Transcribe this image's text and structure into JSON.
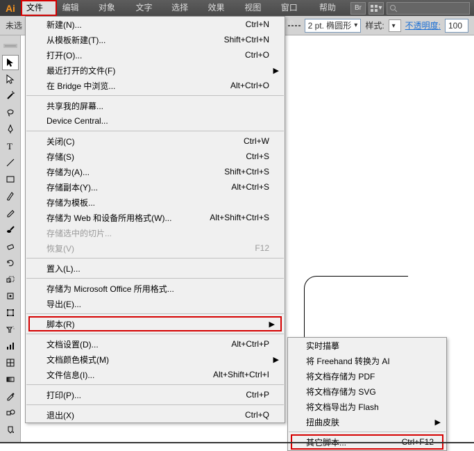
{
  "menubar": {
    "file": "文件(F)",
    "edit": "编辑(E)",
    "object": "对象(O)",
    "text": "文字(T)",
    "select": "选择(S)",
    "effect": "效果(C)",
    "view": "视图(V)",
    "window": "窗口(W)",
    "help": "帮助(H)",
    "br_btn": "Br"
  },
  "optbar": {
    "left_label": "未选",
    "stroke_opts": "2 pt. 椭圆形",
    "style_label": "样式:",
    "opacity_label": "不透明度:",
    "opacity_value": "100"
  },
  "file_menu": [
    {
      "type": "item",
      "label": "新建(N)...",
      "shortcut": "Ctrl+N"
    },
    {
      "type": "item",
      "label": "从模板新建(T)...",
      "shortcut": "Shift+Ctrl+N"
    },
    {
      "type": "item",
      "label": "打开(O)...",
      "shortcut": "Ctrl+O"
    },
    {
      "type": "item",
      "label": "最近打开的文件(F)",
      "shortcut": "",
      "submenu": true
    },
    {
      "type": "item",
      "label": "在 Bridge 中浏览...",
      "shortcut": "Alt+Ctrl+O"
    },
    {
      "type": "sep"
    },
    {
      "type": "item",
      "label": "共享我的屏幕...",
      "shortcut": ""
    },
    {
      "type": "item",
      "label": "Device Central...",
      "shortcut": ""
    },
    {
      "type": "sep"
    },
    {
      "type": "item",
      "label": "关闭(C)",
      "shortcut": "Ctrl+W"
    },
    {
      "type": "item",
      "label": "存储(S)",
      "shortcut": "Ctrl+S"
    },
    {
      "type": "item",
      "label": "存储为(A)...",
      "shortcut": "Shift+Ctrl+S"
    },
    {
      "type": "item",
      "label": "存储副本(Y)...",
      "shortcut": "Alt+Ctrl+S"
    },
    {
      "type": "item",
      "label": "存储为模板...",
      "shortcut": ""
    },
    {
      "type": "item",
      "label": "存储为 Web 和设备所用格式(W)...",
      "shortcut": "Alt+Shift+Ctrl+S"
    },
    {
      "type": "item",
      "label": "存储选中的切片...",
      "shortcut": "",
      "disabled": true
    },
    {
      "type": "item",
      "label": "恢复(V)",
      "shortcut": "F12",
      "disabled": true
    },
    {
      "type": "sep"
    },
    {
      "type": "item",
      "label": "置入(L)...",
      "shortcut": ""
    },
    {
      "type": "sep"
    },
    {
      "type": "item",
      "label": "存储为 Microsoft Office 所用格式...",
      "shortcut": ""
    },
    {
      "type": "item",
      "label": "导出(E)...",
      "shortcut": ""
    },
    {
      "type": "sep"
    },
    {
      "type": "item",
      "label": "脚本(R)",
      "shortcut": "",
      "submenu": true,
      "boxed": true
    },
    {
      "type": "sep"
    },
    {
      "type": "item",
      "label": "文档设置(D)...",
      "shortcut": "Alt+Ctrl+P"
    },
    {
      "type": "item",
      "label": "文档颜色模式(M)",
      "shortcut": "",
      "submenu": true
    },
    {
      "type": "item",
      "label": "文件信息(I)...",
      "shortcut": "Alt+Shift+Ctrl+I"
    },
    {
      "type": "sep"
    },
    {
      "type": "item",
      "label": "打印(P)...",
      "shortcut": "Ctrl+P"
    },
    {
      "type": "sep"
    },
    {
      "type": "item",
      "label": "退出(X)",
      "shortcut": "Ctrl+Q"
    }
  ],
  "script_submenu": [
    {
      "type": "item",
      "label": "实时描摹"
    },
    {
      "type": "item",
      "label": "将 Freehand 转换为 AI"
    },
    {
      "type": "item",
      "label": "将文档存储为 PDF"
    },
    {
      "type": "item",
      "label": "将文档存储为 SVG"
    },
    {
      "type": "item",
      "label": "将文档导出为 Flash"
    },
    {
      "type": "item",
      "label": "扭曲皮肤",
      "submenu": true
    },
    {
      "type": "sep"
    },
    {
      "type": "item",
      "label": "其它脚本...",
      "shortcut": "Ctrl+F12",
      "boxed": true
    }
  ]
}
